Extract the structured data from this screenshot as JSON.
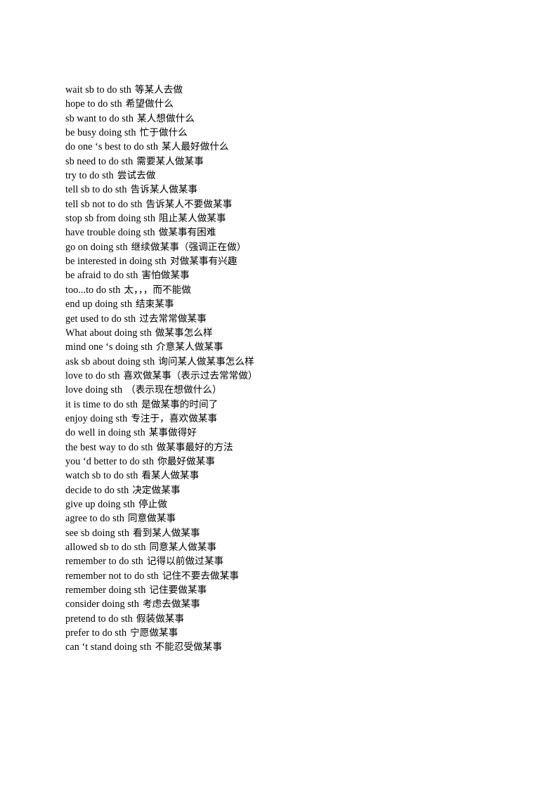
{
  "document": {
    "page_background": "#ffffff",
    "text_color": "#000000",
    "page_number_visible": false,
    "title": "",
    "lines": [
      {
        "en": "wait sb to do sth",
        "cn": "等某人去做"
      },
      {
        "en": "hope to do sth",
        "cn": "希望做什么"
      },
      {
        "en": "sb want to do sth",
        "cn": "某人想做什么"
      },
      {
        "en": "be busy doing sth",
        "cn": "忙于做什么"
      },
      {
        "en": "do one ‘s best to do sth",
        "cn": "某人最好做什么"
      },
      {
        "en": "sb need to do sth",
        "cn": "需要某人做某事"
      },
      {
        "en": "try to do sth",
        "cn": "尝试去做"
      },
      {
        "en": "tell sb to do sth",
        "cn": "告诉某人做某事"
      },
      {
        "en": "tell sb not to do sth",
        "cn": "告诉某人不要做某事"
      },
      {
        "en": "stop sb from doing sth",
        "cn": "阻止某人做某事"
      },
      {
        "en": "have trouble doing sth",
        "cn": "做某事有困难"
      },
      {
        "en": "go on doing sth",
        "cn": "继续做某事（强调正在做）"
      },
      {
        "en": "be interested in doing sth",
        "cn": "对做某事有兴趣"
      },
      {
        "en": "be afraid to do sth",
        "cn": "害怕做某事"
      },
      {
        "en": "too...to do sth",
        "cn": "太，，，而不能做"
      },
      {
        "en": "end up doing sth",
        "cn": "结束某事"
      },
      {
        "en": "get used to do sth",
        "cn": "过去常常做某事"
      },
      {
        "en": "What about doing sth",
        "cn": "做某事怎么样"
      },
      {
        "en": "mind one ‘s doing sth",
        "cn": "介意某人做某事"
      },
      {
        "en": "ask sb about doing sth",
        "cn": "询问某人做某事怎么样"
      },
      {
        "en": "love to do sth",
        "cn": "喜欢做某事（表示过去常常做）"
      },
      {
        "en": "love doing sth",
        "cn": "（表示现在想做什么）"
      },
      {
        "en": "it is time to do sth",
        "cn": "是做某事的时间了"
      },
      {
        "en": "enjoy doing sth",
        "cn": "专注于，喜欢做某事"
      },
      {
        "en": "do well in doing sth",
        "cn": "某事做得好"
      },
      {
        "en": "the best way to do sth",
        "cn": "做某事最好的方法"
      },
      {
        "en": "you ‘d better to do sth",
        "cn": "你最好做某事"
      },
      {
        "en": "watch sb to do sth",
        "cn": "看某人做某事"
      },
      {
        "en": "decide to do sth",
        "cn": "决定做某事"
      },
      {
        "en": "give up doing sth",
        "cn": "停止做"
      },
      {
        "en": "agree to do sth",
        "cn": "同意做某事"
      },
      {
        "en": "see sb doing sth",
        "cn": "看到某人做某事"
      },
      {
        "en": "allowed sb to do sth",
        "cn": "同意某人做某事"
      },
      {
        "en": "remember to do sth",
        "cn": "记得以前做过某事"
      },
      {
        "en": "remember not to do sth",
        "cn": "记住不要去做某事"
      },
      {
        "en": "remember doing sth",
        "cn": "记住要做某事"
      },
      {
        "en": "consider doing sth",
        "cn": "考虑去做某事"
      },
      {
        "en": "pretend to do sth",
        "cn": "假装做某事"
      },
      {
        "en": "prefer to do sth",
        "cn": "宁愿做某事"
      },
      {
        "en": "can ‘t stand doing sth",
        "cn": "不能忍受做某事"
      }
    ]
  }
}
